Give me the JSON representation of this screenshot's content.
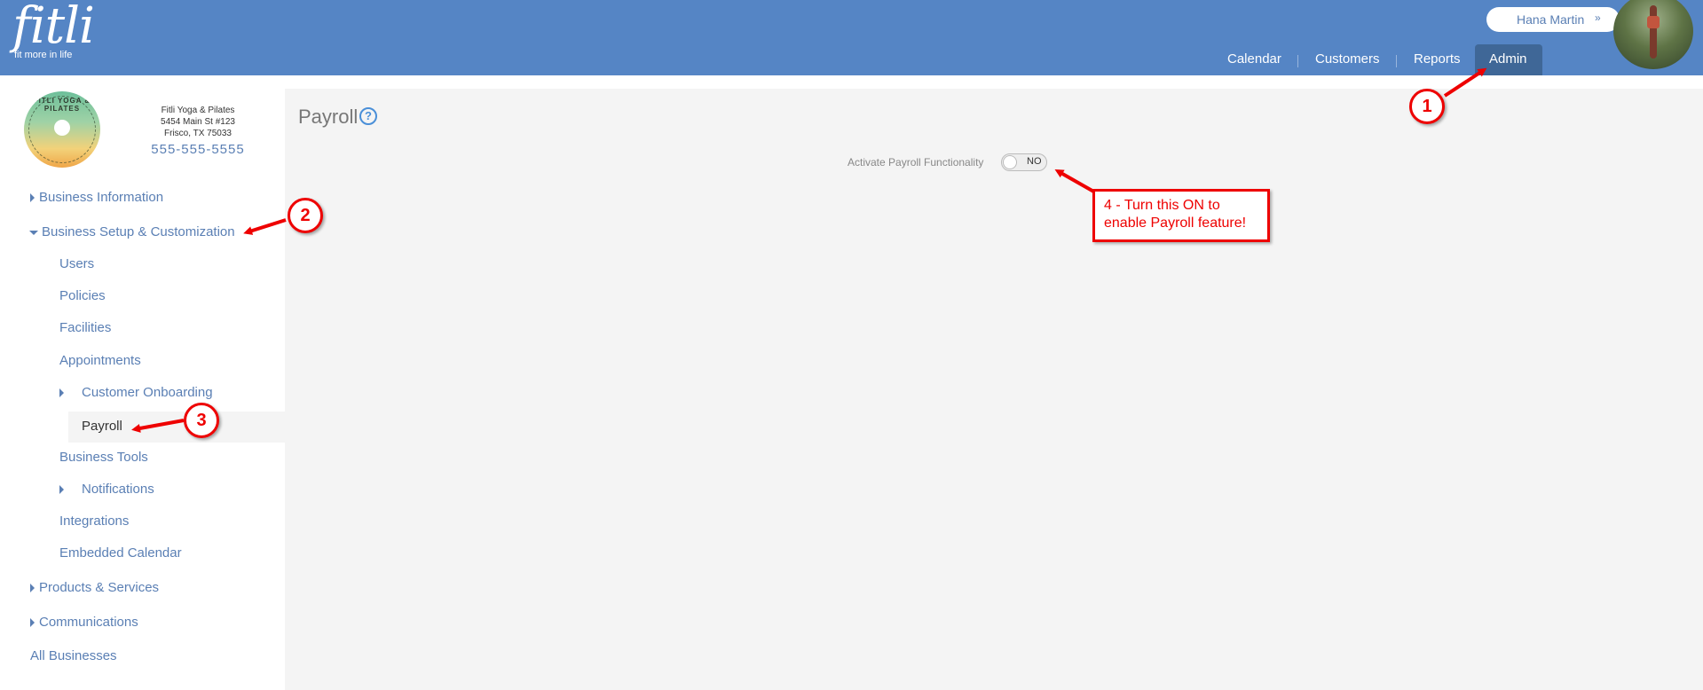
{
  "header": {
    "logo_word": "fitli",
    "logo_tagline": "fit more in life",
    "user_name": "Hana Martin",
    "user_chevron": "»",
    "nav": [
      "Calendar",
      "Customers",
      "Reports",
      "Admin"
    ],
    "active_nav": "Admin"
  },
  "business": {
    "logo_text": "FITLI YOGA & PILATES",
    "name": "Fitli Yoga & Pilates",
    "address1": "5454 Main St #123",
    "address2": "Frisco, TX 75033",
    "phone": "555-555-5555"
  },
  "sidebar": {
    "business_information": "Business Information",
    "business_setup": "Business Setup & Customization",
    "users": "Users",
    "policies": "Policies",
    "facilities": "Facilities",
    "appointments": "Appointments",
    "customer_onboarding": "Customer Onboarding",
    "payroll": "Payroll",
    "business_tools": "Business Tools",
    "notifications": "Notifications",
    "integrations": "Integrations",
    "embedded_calendar": "Embedded Calendar",
    "products_services": "Products & Services",
    "communications": "Communications",
    "all_businesses": "All Businesses"
  },
  "main": {
    "title": "Payroll",
    "help_icon": "?",
    "toggle_label": "Activate Payroll Functionality",
    "toggle_state": "NO"
  },
  "annotations": {
    "step1": "1",
    "step2": "2",
    "step3": "3",
    "callout_line1": "4 - Turn this ON to",
    "callout_line2": "enable Payroll feature!",
    "color": "#e00000"
  },
  "colors": {
    "header_bg": "#5585c5",
    "active_tab_bg": "#3f6797",
    "link": "#5a7fb4",
    "content_bg": "#f4f4f4"
  }
}
